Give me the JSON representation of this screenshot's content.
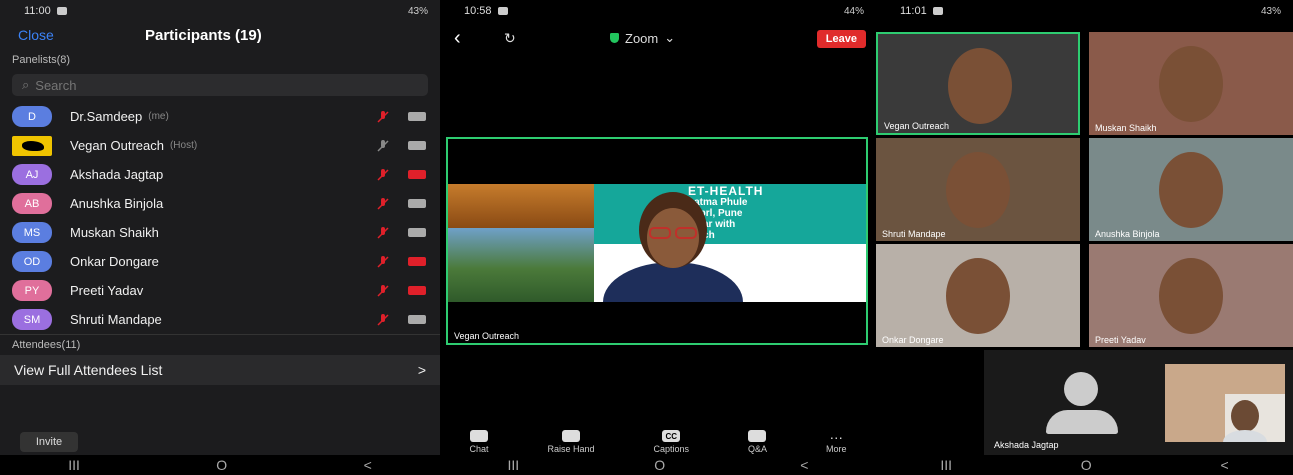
{
  "panel1": {
    "status_time": "11:00",
    "battery": "43%",
    "close_label": "Close",
    "title": "Participants (19)",
    "panelists_label": "Panelists(8)",
    "search_placeholder": "Search",
    "participants": [
      {
        "initials": "D",
        "name": "Dr.Samdeep",
        "tag": "(me)",
        "color": "#5b7ee0",
        "cam_on": true
      },
      {
        "initials": "",
        "name": "Vegan Outreach",
        "tag": "(Host)",
        "color": "#f0c400",
        "cam_on": true
      },
      {
        "initials": "AJ",
        "name": "Akshada Jagtap",
        "tag": "",
        "color": "#9b6fe0",
        "cam_on": false
      },
      {
        "initials": "AB",
        "name": "Anushka Binjola",
        "tag": "",
        "color": "#e06f9b",
        "cam_on": true
      },
      {
        "initials": "MS",
        "name": "Muskan Shaikh",
        "tag": "",
        "color": "#5b7ee0",
        "cam_on": true
      },
      {
        "initials": "OD",
        "name": "Onkar Dongare",
        "tag": "",
        "color": "#5b7ee0",
        "cam_on": false
      },
      {
        "initials": "PY",
        "name": "Preeti Yadav",
        "tag": "",
        "color": "#e06f9b",
        "cam_on": false
      },
      {
        "initials": "SM",
        "name": "Shruti Mandape",
        "tag": "",
        "color": "#9b6fe0",
        "cam_on": true
      }
    ],
    "attendees_label": "Attendees(11)",
    "view_full_label": "View Full Attendees List",
    "view_full_chevron": ">",
    "invite_label": "Invite"
  },
  "panel2": {
    "status_time": "10:58",
    "battery": "44%",
    "zoom_label": "Zoom",
    "leave_label": "Leave",
    "slide_title": "ET-HEALTH",
    "slide_lines": [
      "hatma Phule",
      "imprl, Pune",
      "binar with",
      "reach"
    ],
    "share_name": "Vegan Outreach",
    "toolbar": [
      {
        "label": "Chat",
        "icon": "chat-icon"
      },
      {
        "label": "Raise Hand",
        "icon": "raise-hand-icon"
      },
      {
        "label": "Captions",
        "icon": "captions-icon",
        "glyph": "CC"
      },
      {
        "label": "Q&A",
        "icon": "qa-icon"
      },
      {
        "label": "More",
        "icon": "more-icon"
      }
    ]
  },
  "panel3": {
    "status_time": "11:01",
    "battery": "43%",
    "tiles": [
      {
        "name": "Vegan Outreach",
        "bg": "#3a3a3a",
        "active": true
      },
      {
        "name": "Muskan Shaikh",
        "bg": "#8a5a4a"
      },
      {
        "name": "Shruti Mandape",
        "bg": "#6b5440"
      },
      {
        "name": "Anushka Binjola",
        "bg": "#7a8a8a"
      },
      {
        "name": "Onkar Dongare",
        "bg": "#b8b0a8"
      },
      {
        "name": "Preeti Yadav",
        "bg": "#9a7a72"
      }
    ],
    "self_name": "Akshada Jagtap"
  },
  "nav_glyphs": [
    "III",
    "O",
    "<"
  ]
}
